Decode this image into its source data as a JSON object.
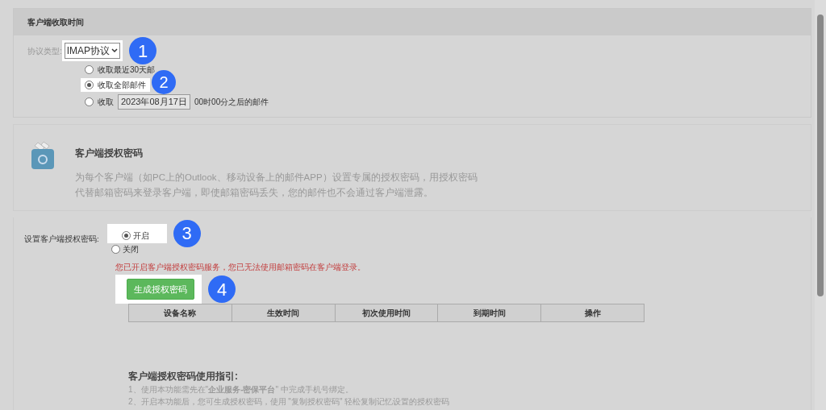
{
  "fetch_section": {
    "title": "客户端收取时间",
    "protocol_label": "协议类型:",
    "protocol_value": "IMAP协议",
    "protocol_badge": "1",
    "options": [
      {
        "kind": "plain",
        "label": "收取最近30天邮",
        "selected": false
      },
      {
        "kind": "plain",
        "label": "收取全部邮件",
        "selected": true,
        "badge": "2"
      },
      {
        "kind": "date",
        "label": "收取",
        "date": "2023年08月17日",
        "suffix": "00时00分之后的邮件",
        "selected": false
      }
    ]
  },
  "auth_intro": {
    "title": "客户端授权密码",
    "description": "为每个客户端（如PC上的Outlook、移动设备上的邮件APP）设置专属的授权密码，用授权密码代替邮箱密码来登录客户端，即使邮箱密码丢失，您的邮件也不会通过客户端泄露。"
  },
  "auth_setting": {
    "label": "设置客户端授权密码:",
    "badge": "3",
    "options": [
      {
        "label": "开启",
        "selected": true
      },
      {
        "label": "关闭",
        "selected": false
      }
    ],
    "warning": "您已开启客户端授权密码服务，您已无法使用邮箱密码在客户端登录。",
    "generate_button": "生成授权密码",
    "button_badge": "4",
    "table": {
      "columns": [
        "设备名称",
        "生效时间",
        "初次使用时间",
        "到期时间",
        "操作"
      ]
    },
    "guide": {
      "title": "客户端授权密码使用指引:",
      "lines": [
        "1、使用本功能需先在\"**企业服务-密保平台**\" 中完成手机号绑定。",
        "2、开启本功能后，您可生成授权密码，使用 \"复制授权密码\" 轻松复制记忆设置的授权密码"
      ]
    }
  }
}
